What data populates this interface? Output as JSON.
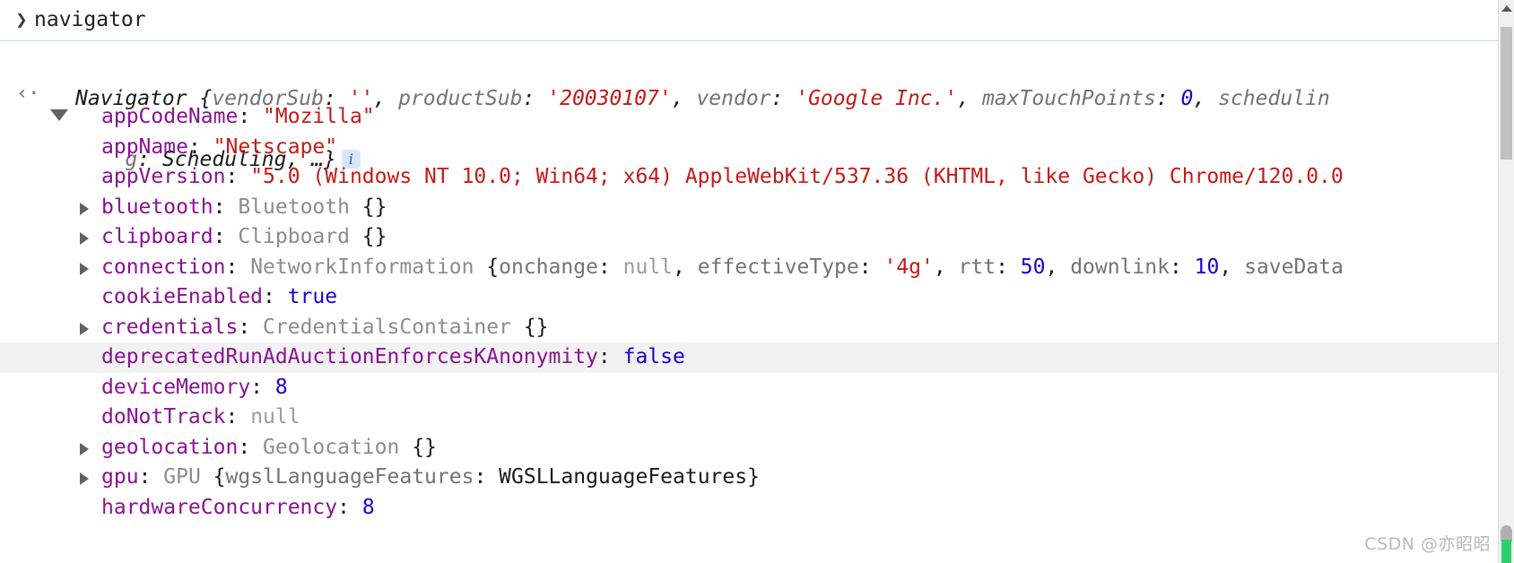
{
  "console": {
    "prompt": {
      "chevron": "chevron-right-icon",
      "expression": "navigator"
    },
    "result": {
      "back_arrow": "‹·",
      "head_line_1": [
        {
          "text": "Navigator",
          "cls": "t-class"
        },
        {
          "text": " {",
          "cls": "t-punct"
        },
        {
          "text": "vendorSub",
          "cls": "t-keyg"
        },
        {
          "text": ": ",
          "cls": "t-punct"
        },
        {
          "text": "''",
          "cls": "t-string"
        },
        {
          "text": ", ",
          "cls": "t-punct"
        },
        {
          "text": "productSub",
          "cls": "t-keyg"
        },
        {
          "text": ": ",
          "cls": "t-punct"
        },
        {
          "text": "'20030107'",
          "cls": "t-string"
        },
        {
          "text": ", ",
          "cls": "t-punct"
        },
        {
          "text": "vendor",
          "cls": "t-keyg"
        },
        {
          "text": ": ",
          "cls": "t-punct"
        },
        {
          "text": "'Google Inc.'",
          "cls": "t-string"
        },
        {
          "text": ", ",
          "cls": "t-punct"
        },
        {
          "text": "maxTouchPoints",
          "cls": "t-keyg"
        },
        {
          "text": ": ",
          "cls": "t-punct"
        },
        {
          "text": "0",
          "cls": "t-number"
        },
        {
          "text": ", ",
          "cls": "t-punct"
        },
        {
          "text": "schedulin",
          "cls": "t-keyg"
        }
      ],
      "head_line_2": [
        {
          "text": "g",
          "cls": "t-keyg"
        },
        {
          "text": ": ",
          "cls": "t-punct"
        },
        {
          "text": "Scheduling",
          "cls": "t-class"
        },
        {
          "text": ", …}",
          "cls": "t-punct"
        }
      ],
      "info_badge": "i"
    },
    "properties": [
      {
        "name": "appCodeName",
        "expandable": false,
        "highlight": false,
        "tokens": [
          {
            "text": "appCodeName",
            "cls": "t-key"
          },
          {
            "text": ": ",
            "cls": "t-punct"
          },
          {
            "text": "\"Mozilla\"",
            "cls": "t-string"
          }
        ]
      },
      {
        "name": "appName",
        "expandable": false,
        "highlight": false,
        "tokens": [
          {
            "text": "appName",
            "cls": "t-key"
          },
          {
            "text": ": ",
            "cls": "t-punct"
          },
          {
            "text": "\"Netscape\"",
            "cls": "t-string"
          }
        ]
      },
      {
        "name": "appVersion",
        "expandable": false,
        "highlight": false,
        "tokens": [
          {
            "text": "appVersion",
            "cls": "t-key"
          },
          {
            "text": ": ",
            "cls": "t-punct"
          },
          {
            "text": "\"5.0 (Windows NT 10.0; Win64; x64) AppleWebKit/537.36 (KHTML, like Gecko) Chrome/120.0.0",
            "cls": "t-string"
          }
        ]
      },
      {
        "name": "bluetooth",
        "expandable": true,
        "highlight": false,
        "tokens": [
          {
            "text": "bluetooth",
            "cls": "t-key"
          },
          {
            "text": ": ",
            "cls": "t-punct"
          },
          {
            "text": "Bluetooth",
            "cls": "t-object"
          },
          {
            "text": " {}",
            "cls": "t-punct"
          }
        ]
      },
      {
        "name": "clipboard",
        "expandable": true,
        "highlight": false,
        "tokens": [
          {
            "text": "clipboard",
            "cls": "t-key"
          },
          {
            "text": ": ",
            "cls": "t-punct"
          },
          {
            "text": "Clipboard",
            "cls": "t-object"
          },
          {
            "text": " {}",
            "cls": "t-punct"
          }
        ]
      },
      {
        "name": "connection",
        "expandable": true,
        "highlight": false,
        "tokens": [
          {
            "text": "connection",
            "cls": "t-key"
          },
          {
            "text": ": ",
            "cls": "t-punct"
          },
          {
            "text": "NetworkInformation",
            "cls": "t-object"
          },
          {
            "text": " {",
            "cls": "t-punct"
          },
          {
            "text": "onchange",
            "cls": "t-keyg"
          },
          {
            "text": ": ",
            "cls": "t-punct"
          },
          {
            "text": "null",
            "cls": "t-null"
          },
          {
            "text": ", ",
            "cls": "t-punct"
          },
          {
            "text": "effectiveType",
            "cls": "t-keyg"
          },
          {
            "text": ": ",
            "cls": "t-punct"
          },
          {
            "text": "'4g'",
            "cls": "t-string"
          },
          {
            "text": ", ",
            "cls": "t-punct"
          },
          {
            "text": "rtt",
            "cls": "t-keyg"
          },
          {
            "text": ": ",
            "cls": "t-punct"
          },
          {
            "text": "50",
            "cls": "t-number"
          },
          {
            "text": ", ",
            "cls": "t-punct"
          },
          {
            "text": "downlink",
            "cls": "t-keyg"
          },
          {
            "text": ": ",
            "cls": "t-punct"
          },
          {
            "text": "10",
            "cls": "t-number"
          },
          {
            "text": ", ",
            "cls": "t-punct"
          },
          {
            "text": "saveData",
            "cls": "t-keyg"
          }
        ]
      },
      {
        "name": "cookieEnabled",
        "expandable": false,
        "highlight": false,
        "tokens": [
          {
            "text": "cookieEnabled",
            "cls": "t-key"
          },
          {
            "text": ": ",
            "cls": "t-punct"
          },
          {
            "text": "true",
            "cls": "t-bool"
          }
        ]
      },
      {
        "name": "credentials",
        "expandable": true,
        "highlight": false,
        "tokens": [
          {
            "text": "credentials",
            "cls": "t-key"
          },
          {
            "text": ": ",
            "cls": "t-punct"
          },
          {
            "text": "CredentialsContainer",
            "cls": "t-object"
          },
          {
            "text": " {}",
            "cls": "t-punct"
          }
        ]
      },
      {
        "name": "deprecatedRunAdAuctionEnforcesKAnonymity",
        "expandable": false,
        "highlight": true,
        "tokens": [
          {
            "text": "deprecatedRunAdAuctionEnforcesKAnonymity",
            "cls": "t-key"
          },
          {
            "text": ": ",
            "cls": "t-punct"
          },
          {
            "text": "false",
            "cls": "t-bool"
          }
        ]
      },
      {
        "name": "deviceMemory",
        "expandable": false,
        "highlight": false,
        "tokens": [
          {
            "text": "deviceMemory",
            "cls": "t-key"
          },
          {
            "text": ": ",
            "cls": "t-punct"
          },
          {
            "text": "8",
            "cls": "t-number"
          }
        ]
      },
      {
        "name": "doNotTrack",
        "expandable": false,
        "highlight": false,
        "tokens": [
          {
            "text": "doNotTrack",
            "cls": "t-key"
          },
          {
            "text": ": ",
            "cls": "t-punct"
          },
          {
            "text": "null",
            "cls": "t-null"
          }
        ]
      },
      {
        "name": "geolocation",
        "expandable": true,
        "highlight": false,
        "tokens": [
          {
            "text": "geolocation",
            "cls": "t-key"
          },
          {
            "text": ": ",
            "cls": "t-punct"
          },
          {
            "text": "Geolocation",
            "cls": "t-object"
          },
          {
            "text": " {}",
            "cls": "t-punct"
          }
        ]
      },
      {
        "name": "gpu",
        "expandable": true,
        "highlight": false,
        "tokens": [
          {
            "text": "gpu",
            "cls": "t-key"
          },
          {
            "text": ": ",
            "cls": "t-punct"
          },
          {
            "text": "GPU",
            "cls": "t-object"
          },
          {
            "text": " {",
            "cls": "t-punct"
          },
          {
            "text": "wgslLanguageFeatures",
            "cls": "t-keyg"
          },
          {
            "text": ": ",
            "cls": "t-punct"
          },
          {
            "text": "WGSLLanguageFeatures",
            "cls": "t-plain"
          },
          {
            "text": "}",
            "cls": "t-punct"
          }
        ]
      },
      {
        "name": "hardwareConcurrency",
        "expandable": false,
        "highlight": false,
        "tokens": [
          {
            "text": "hardwareConcurrency",
            "cls": "t-key"
          },
          {
            "text": ": ",
            "cls": "t-punct"
          },
          {
            "text": "8",
            "cls": "t-number"
          }
        ]
      }
    ],
    "scrollbar": {
      "up_arrow": "scroll-up-arrow-icon"
    },
    "watermark": "CSDN @亦昭昭"
  },
  "colors": {
    "property_name": "#881391",
    "string": "#c41a16",
    "number": "#1c00cf",
    "object_type": "#8c8c8c",
    "null": "#9b9b9b",
    "highlight_row": "#f2f2f2",
    "separator": "#c8d9ee"
  }
}
